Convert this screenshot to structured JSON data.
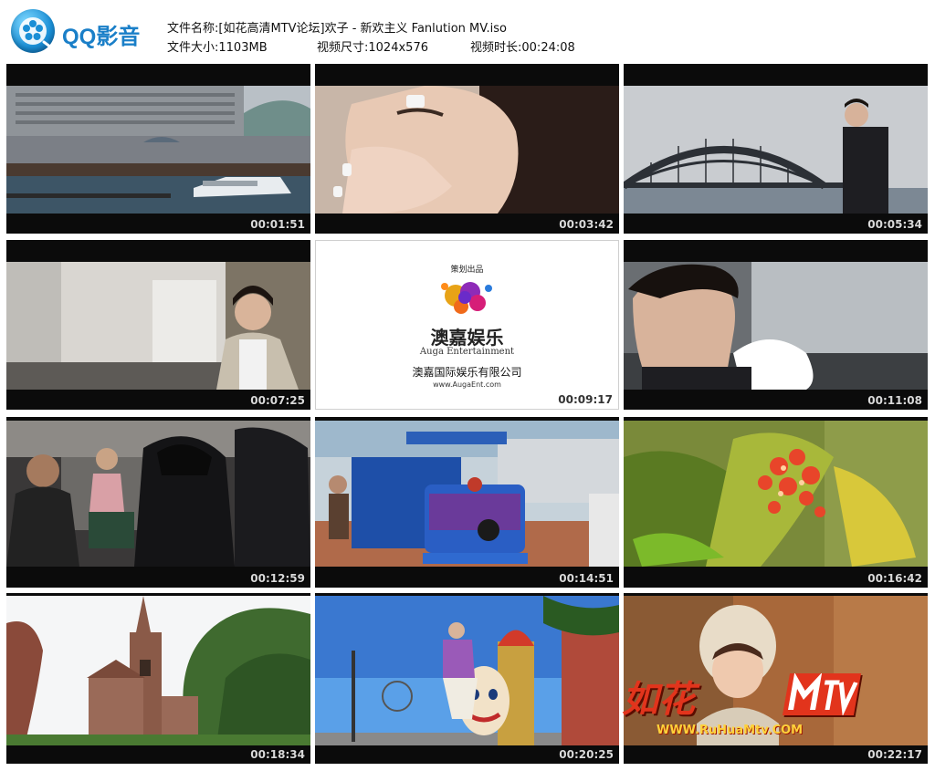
{
  "header": {
    "logo_text": "QQ影音",
    "file_name_label": "文件名称:",
    "file_name": "[如花高清MTV论坛]欢子 - 新欢主义 Fanlution MV.iso",
    "file_size_label": "文件大小:",
    "file_size": "1103MB",
    "video_size_label": "视频尺寸:",
    "video_size": "1024x576",
    "duration_label": "视频时长:",
    "duration": "00:24:08"
  },
  "thumbnails": [
    {
      "time": "00:01:51",
      "scene": "harbor-building"
    },
    {
      "time": "00:03:42",
      "scene": "woman-face"
    },
    {
      "time": "00:05:34",
      "scene": "bridge-man"
    },
    {
      "time": "00:07:25",
      "scene": "man-kitchen"
    },
    {
      "time": "00:09:17",
      "scene": "logo-card"
    },
    {
      "time": "00:11:08",
      "scene": "man-car"
    },
    {
      "time": "00:12:59",
      "scene": "train-passengers"
    },
    {
      "time": "00:14:51",
      "scene": "tourist-train"
    },
    {
      "time": "00:16:42",
      "scene": "red-flowers"
    },
    {
      "time": "00:18:34",
      "scene": "church"
    },
    {
      "time": "00:20:25",
      "scene": "luna-park"
    },
    {
      "time": "00:22:17",
      "scene": "girl-watermark"
    }
  ],
  "logo_card": {
    "top_text": "策划出品",
    "company_cn": "澳嘉娱乐",
    "company_en": "Auga Entertainment",
    "company_full": "澳嘉国际娱乐有限公司",
    "url": "www.AugaEnt.com"
  },
  "watermark": {
    "text": "如花",
    "url": "WWW.RuHuaMtv.COM"
  },
  "colors": {
    "accent": "#1a7fc8",
    "frame_bg": "#0b0b0b"
  }
}
